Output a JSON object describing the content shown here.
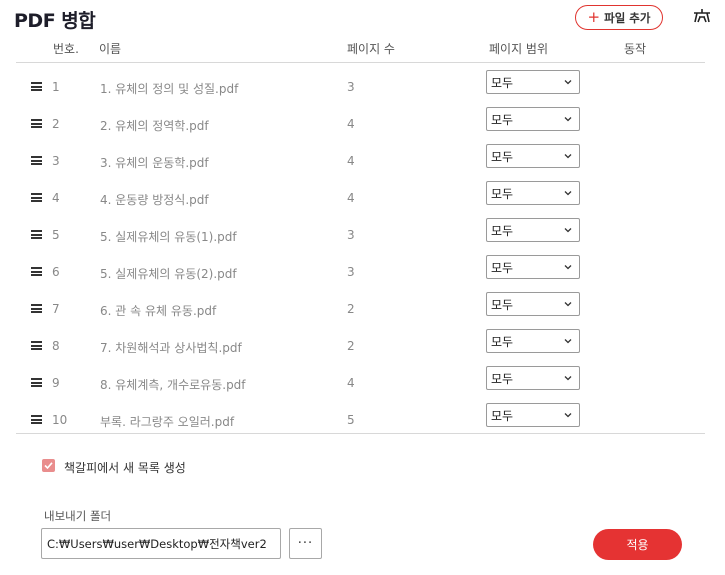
{
  "header": {
    "title": "PDF 병합",
    "add_button": "파일 추가",
    "add_icon": "+"
  },
  "columns": {
    "number": "번호.",
    "name": "이름",
    "pages": "페이지 수",
    "range": "페이지 범위",
    "action": "동작"
  },
  "rows": [
    {
      "no": "1",
      "name": "1. 유체의 정의 및 성질.pdf",
      "pages": "3",
      "range": "모두"
    },
    {
      "no": "2",
      "name": "2. 유체의 정역학.pdf",
      "pages": "4",
      "range": "모두"
    },
    {
      "no": "3",
      "name": "3. 유체의 운동학.pdf",
      "pages": "4",
      "range": "모두"
    },
    {
      "no": "4",
      "name": "4. 운동량 방정식.pdf",
      "pages": "4",
      "range": "모두"
    },
    {
      "no": "5",
      "name": "5. 실제유체의 유동(1).pdf",
      "pages": "3",
      "range": "모두"
    },
    {
      "no": "6",
      "name": "5. 실제유체의 유동(2).pdf",
      "pages": "3",
      "range": "모두"
    },
    {
      "no": "7",
      "name": "6. 관 속 유체 유동.pdf",
      "pages": "2",
      "range": "모두"
    },
    {
      "no": "8",
      "name": "7. 차원해석과 상사법칙.pdf",
      "pages": "2",
      "range": "모두"
    },
    {
      "no": "9",
      "name": "8. 유체계측, 개수로유동.pdf",
      "pages": "4",
      "range": "모두"
    },
    {
      "no": "10",
      "name": "부록. 라그랑주 오일러.pdf",
      "pages": "5",
      "range": "모두"
    }
  ],
  "bookmark": {
    "label": "책갈피에서 새 목록 생성",
    "checked": true
  },
  "export": {
    "label": "내보내기 폴더",
    "path": "C:₩Users₩user₩Desktop₩전자책ver2",
    "browse": "···"
  },
  "apply_button": "적용",
  "colors": {
    "accent": "#e53333",
    "checkbox": "#e98d8d"
  }
}
